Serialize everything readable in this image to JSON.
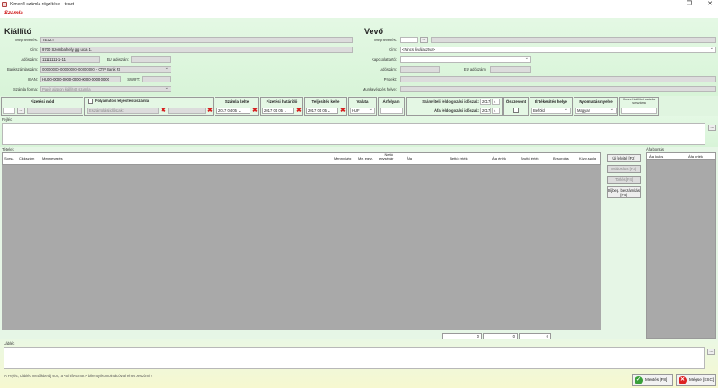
{
  "window": {
    "title": "Kimenő számla rögzítése - teszt",
    "minimize": "—",
    "maximize": "❐",
    "close": "✕"
  },
  "menu": {
    "item": "Számla"
  },
  "kiallito": {
    "title": "Kiállító",
    "megnevezes_label": "Megnevezés:",
    "megnevezes": "TESZT",
    "cim_label": "Cím:",
    "cim": "9700 Szombathely, gg utca 1.",
    "adoszam_label": "Adószám:",
    "adoszam": "11111111-1-11",
    "eu_adoszam_label": "EU adószám:",
    "eu_adoszam": "",
    "bankszamla_label": "Bankszámlaszám:",
    "bankszamla": "00000000-00000000-00000000 - OTP Bank Rt",
    "iban_label": "IBAN:",
    "iban": "HU00-0000-0000-0000-0000-0000-0000",
    "swift_label": "SWIFT:",
    "swift": "",
    "szamla_forma_label": "Számla forma:",
    "szamla_forma": "Papír alapon kiállított számla"
  },
  "vevo": {
    "title": "Vevő",
    "megnevezes_label": "Megnevezés:",
    "cim_label": "Cím:",
    "cim": "<Nincs kiválasztva>",
    "kapcsolattarto_label": "Kapcsolattartó:",
    "adoszam_label": "Adószám:",
    "eu_adoszam_label": "EU adószám:",
    "projekt_label": "Projekt:",
    "munkavegzes_label": "Munkavégzés helye:"
  },
  "strip": {
    "fizetesi_mod": "Fizetési mód",
    "folyamatos_label": "Folyamatos teljesítésű számla",
    "elszamolasi_placeholder": "Elszámolási időszak:",
    "szamla_kelte": "Számla kelte",
    "fizetesi_hatarido": "Fizetési határidő",
    "teljesites_kelte": "Teljesítés kelte",
    "date_year": "2017",
    "date_month": "04",
    "date_day": "05",
    "valuta": "Valuta",
    "valuta_value": "HUF",
    "arfolyam": "Árfolyam",
    "szamviteli_label": "Számviteli feldolgozási időszak:",
    "afa_label": "Áfa feldolgozási időszak:",
    "period_year": "2017",
    "period_month": "4",
    "osszevont": "Összevont",
    "ertekesites": "Értékesítés helye",
    "ertekesites_value": "Belföld",
    "nyomtatas": "Nyomtatás nyelve",
    "nyomtatas_value": "Magyar",
    "kezzel_label": "Kézzel kiállított számla sorszáma"
  },
  "fejlec_label": "Fejléc",
  "tetelek": {
    "label": "Tételek",
    "columns": [
      "Sorsz.",
      "Cikkszám",
      "Megnevezés",
      "Mennyiség",
      "Me. egys.",
      "Nettó egységár",
      "Áfa",
      "Nettó érték",
      "Áfa érték",
      "Bruttó érték",
      "Besorolás",
      "Közv.szolg"
    ],
    "totals": [
      "0",
      "0",
      "0"
    ]
  },
  "side_buttons": {
    "uj": "Új felvitel [F2]",
    "modositas": "Módosítás [F3]",
    "torles": "Törlés [F4]",
    "dijbeg": "Díjbeg. beszámítás [F5]"
  },
  "afa_bontas": {
    "label": "Áfa bontás",
    "col1": "Áfa kulcs",
    "col2": "Áfa érték"
  },
  "lablec_label": "Lábléc",
  "hint": "A Fejléc, Lábléc mezőkbe új sort, a <Shift+Enter> billentyűkombinációval lehet beszúrni !",
  "buttons": {
    "mentes": "Mentés [F8]",
    "megse": "Mégse [ESC]"
  },
  "colors": {
    "accent_red": "#cc1111",
    "panel_green": "#e0f5e0",
    "grid_gray": "#a9a9a9"
  }
}
